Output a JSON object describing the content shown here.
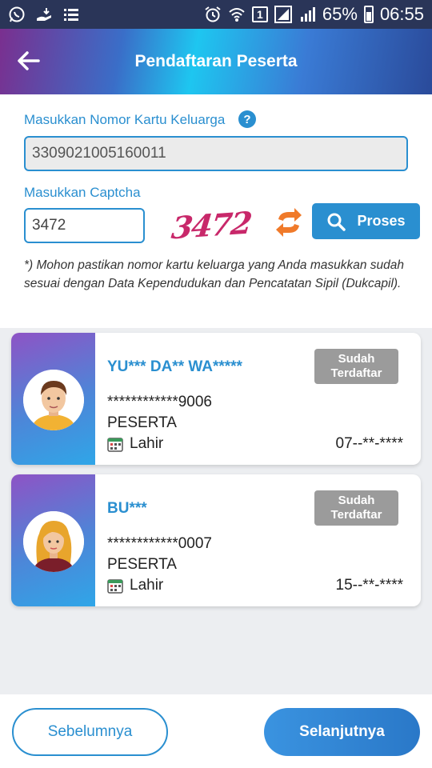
{
  "status_bar": {
    "battery": "65%",
    "time": "06:55",
    "sim_badge": "1",
    "icons": [
      "whatsapp-icon",
      "hand-icon",
      "list-icon",
      "alarm-icon",
      "wifi-icon",
      "sim-icon",
      "signal-icon",
      "signal-icon",
      "battery-icon"
    ]
  },
  "header": {
    "title": "Pendaftaran Peserta",
    "back_icon": "arrow-left-icon"
  },
  "form": {
    "kk_label": "Masukkan Nomor Kartu Keluarga",
    "help_glyph": "?",
    "kk_value": "3309021005160011",
    "captcha_label": "Masukkan Captcha",
    "captcha_input": "3472",
    "captcha_image_text": "3472",
    "proses_label": "Proses",
    "note": "*) Mohon pastikan nomor kartu keluarga yang Anda masukkan sudah sesuai dengan Data Kependudukan dan Pencatatan Sipil (Dukcapil)."
  },
  "participants": [
    {
      "name": "YU*** DA** WA*****",
      "badge_line1": "Sudah",
      "badge_line2": "Terdaftar",
      "nik": "************9006",
      "role": "PESERTA",
      "birth_label": "Lahir",
      "birth_value": "07--**-****"
    },
    {
      "name": "BU***",
      "badge_line1": "Sudah",
      "badge_line2": "Terdaftar",
      "nik": "************0007",
      "role": "PESERTA",
      "birth_label": "Lahir",
      "birth_value": "15--**-****"
    }
  ],
  "footer": {
    "prev_label": "Sebelumnya",
    "next_label": "Selanjutnya"
  },
  "colors": {
    "accent": "#2a8fd0",
    "badge": "#9b9b9b",
    "captcha": "#c8286a",
    "refresh": "#f07a2a"
  }
}
